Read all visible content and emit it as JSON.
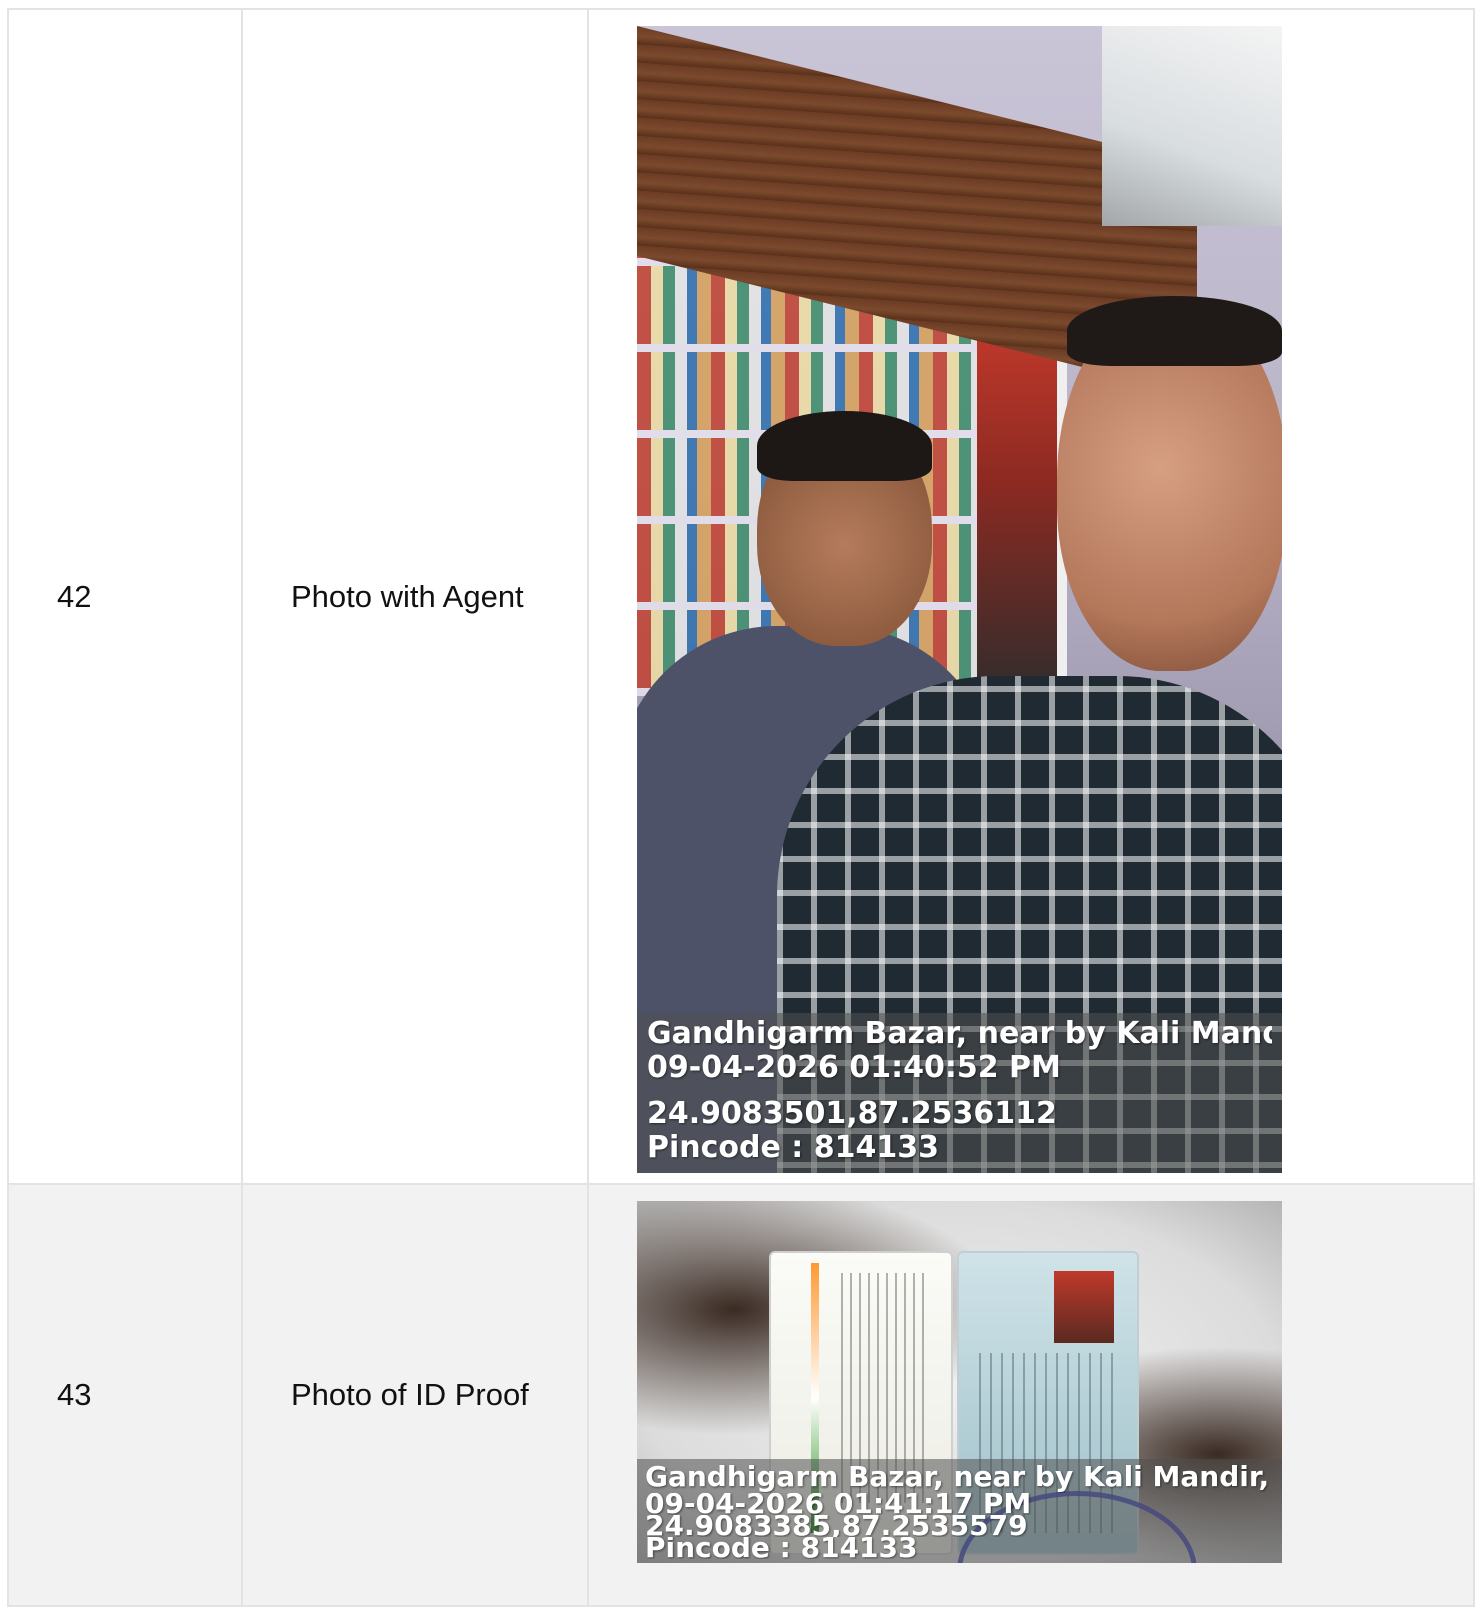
{
  "rows": [
    {
      "number": "42",
      "label": "Photo with Agent",
      "photo": {
        "location": "Gandhigarm Bazar, near by Kali Mandir, ...",
        "datetime": "09-04-2026 01:40:52 PM",
        "coordinates": "24.9083501,87.2536112",
        "pincode": "Pincode : 814133"
      }
    },
    {
      "number": "43",
      "label": "Photo of ID Proof",
      "photo": {
        "location": "Gandhigarm Bazar, near by Kali Mandir, ...",
        "datetime": "09-04-2026 01:41:17 PM",
        "coordinates": "24.9083385,87.2535579",
        "pincode": "Pincode : 814133"
      }
    }
  ],
  "colors": {
    "border": "#e3e3e3",
    "alt_row": "#f2f2f2",
    "overlay_text": "#ffffff"
  }
}
